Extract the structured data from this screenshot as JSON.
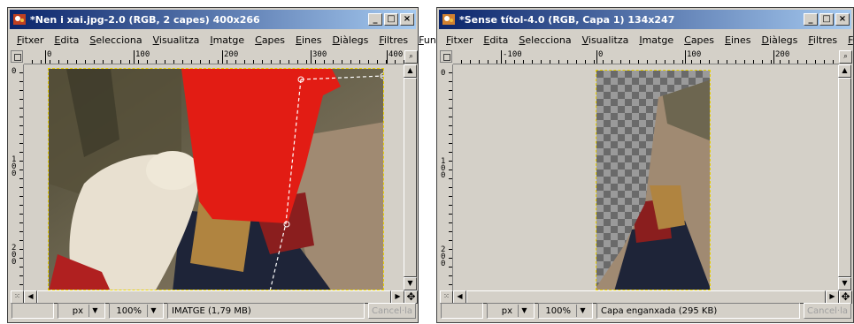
{
  "windows": [
    {
      "title": "*Nen i xai.jpg-2.0 (RGB, 2 capes) 400x266",
      "menu": [
        "Fitxer",
        "Edita",
        "Selecciona",
        "Visualitza",
        "Imatge",
        "Capes",
        "Eines",
        "Diàlegs",
        "Filtres",
        "Funcions"
      ],
      "ruler_h": [
        "0",
        "100",
        "200",
        "300",
        "400"
      ],
      "ruler_v": [
        "0",
        "100",
        "200"
      ],
      "status": {
        "unit": "px",
        "zoom": "100%",
        "info": "IMATGE (1,79 MB)",
        "cancel": "Cancel·la"
      }
    },
    {
      "title": "*Sense títol-4.0 (RGB, Capa 1) 134x247",
      "menu": [
        "Fitxer",
        "Edita",
        "Selecciona",
        "Visualitza",
        "Imatge",
        "Capes",
        "Eines",
        "Diàlegs",
        "Filtres",
        "Funcions"
      ],
      "ruler_h": [
        "-100",
        "0",
        "100",
        "200"
      ],
      "ruler_v": [
        "0",
        "100",
        "200"
      ],
      "status": {
        "unit": "px",
        "zoom": "100%",
        "info": "Capa enganxada (295 KB)",
        "cancel": "Cancel·la"
      }
    }
  ],
  "window_controls": {
    "minimize": "_",
    "maximize": "□",
    "close": "×"
  },
  "icons": [
    "gimp-icon",
    "ruler-corner-icon",
    "arrow-up-icon",
    "arrow-down-icon",
    "arrow-left-icon",
    "arrow-right-icon",
    "navigate-icon",
    "zoom-icon",
    "quick-mask-icon"
  ],
  "colors": {
    "titlebar_start": "#0a246a",
    "titlebar_end": "#a6caf0",
    "paint_red": "#e21c14",
    "selection": "#e8d000"
  }
}
